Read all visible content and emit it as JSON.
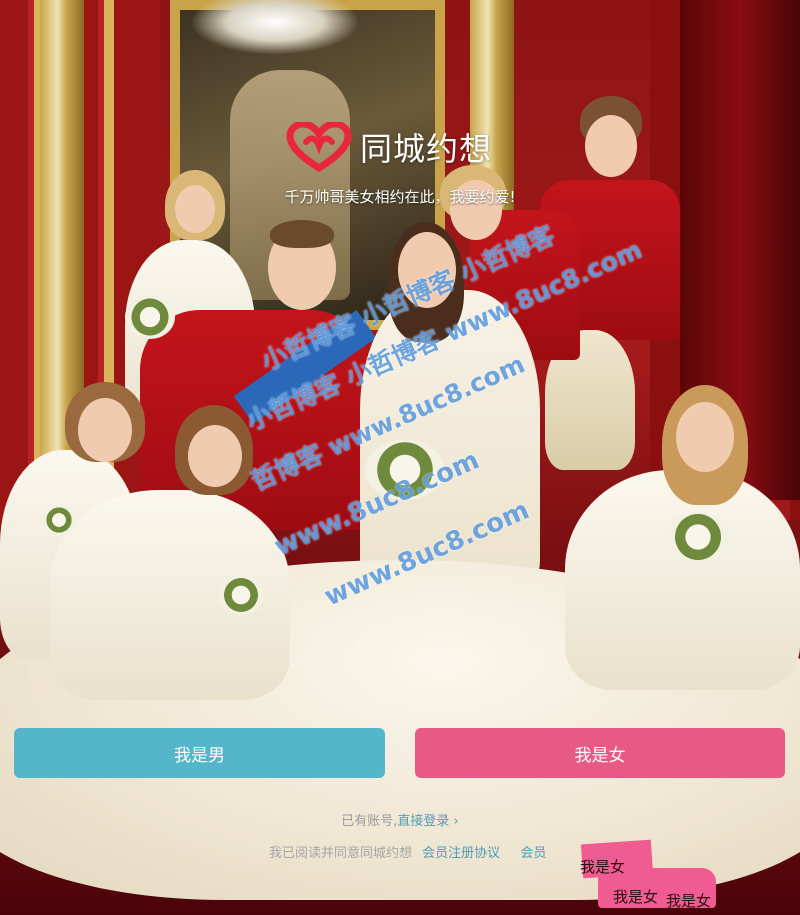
{
  "app": {
    "name": "同城约想",
    "tagline": "千万帅哥美女相约在此，我要约爱!"
  },
  "watermark": {
    "line1": "小哲博客 小哲博客 小哲博客",
    "line2": "小哲博客 小哲博客 www.8uc8.com",
    "line3": "哲博客 www.8uc8.com",
    "line4": "www.8uc8.com",
    "line5": "www.8uc8.com"
  },
  "actions": {
    "male_label": "我是男",
    "female_label": "我是女"
  },
  "login": {
    "prefix": "已有账号,",
    "link": "直接登录 ›"
  },
  "agreement": {
    "prefix": "我已阅读并同意同城约想",
    "link": "会员注册协议",
    "suffix": "会员"
  },
  "overlap": {
    "text1": "我是女",
    "text2": "我是女",
    "text3": "我是女"
  },
  "colors": {
    "male_button": "#55b6cb",
    "female_button": "#e85a86",
    "link": "#4f9db5",
    "logo_heart": "#e8273d"
  }
}
